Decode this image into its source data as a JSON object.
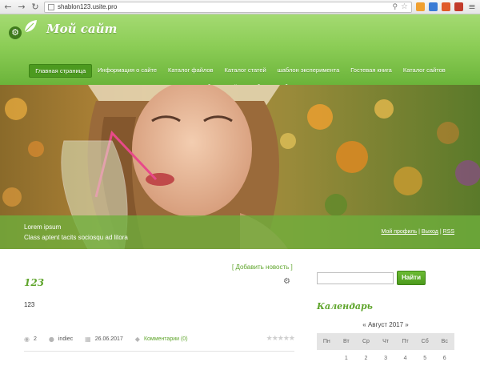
{
  "browser": {
    "url": "shablon123.usite.pro",
    "back_icon": "back-arrow-icon",
    "forward_icon": "forward-arrow-icon",
    "reload_icon": "reload-icon",
    "home_icon": "home-icon",
    "extension_colors": [
      "#f0a030",
      "#3a7bd5",
      "#e05a2a",
      "#c23b2b"
    ]
  },
  "header": {
    "site_title": "Мой сайт",
    "menu": [
      {
        "label": "Главная страница",
        "active": true
      },
      {
        "label": "Информация о сайте",
        "active": false
      },
      {
        "label": "Каталог файлов",
        "active": false
      },
      {
        "label": "Каталог статей",
        "active": false
      },
      {
        "label": "шаблон эксперимента",
        "active": false
      },
      {
        "label": "Гостевая книга",
        "active": false
      },
      {
        "label": "Каталог сайтов",
        "active": false
      },
      {
        "label": "Доска объявлений",
        "active": false
      },
      {
        "label": "щабл инд мобил",
        "active": false
      }
    ]
  },
  "banner": {
    "caption_title": "Lorem ipsum",
    "caption_sub": "Class aptent tacits sociosqu ad litora",
    "links": {
      "profile": "Мой профиль",
      "logout": "Выход",
      "rss": "RSS"
    },
    "separator": "|"
  },
  "content": {
    "add_news": "[ Добавить новость ]",
    "post": {
      "title": "123",
      "body": "123",
      "views": "2",
      "author": "indiec",
      "date": "26.06.2017",
      "comments": "Комментарии (0)"
    }
  },
  "sidebar": {
    "search_placeholder": "",
    "search_button": "Найти",
    "calendar_title": "Календарь",
    "month": "«  Август 2017  »",
    "weekdays": [
      "Пн",
      "Вт",
      "Ср",
      "Чт",
      "Пт",
      "Сб",
      "Вс"
    ],
    "first_row": [
      "",
      "1",
      "2",
      "3",
      "4",
      "5",
      "6"
    ]
  },
  "colors": {
    "accent_green": "#5fa52c",
    "header_green": "#8ccd56"
  }
}
